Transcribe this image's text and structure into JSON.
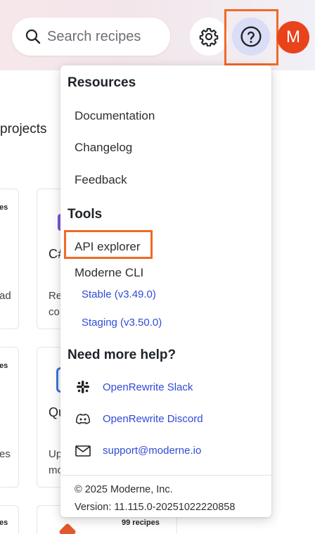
{
  "header": {
    "search_placeholder": "Search recipes",
    "settings_icon": "gear-icon",
    "help_icon": "help-circle-icon",
    "avatar_initial": "M",
    "accent_color": "#f06a26",
    "avatar_color": "#e9431c"
  },
  "background": {
    "section_title_fragment": "projects",
    "cards": [
      {
        "count": "es",
        "text1": "ad",
        "title": ""
      },
      {
        "title": "C#",
        "text1": "Re",
        "text2": "co"
      },
      {
        "count": "es",
        "text1": "es"
      },
      {
        "title": "Qu",
        "text1": "Up",
        "text2": "mo"
      },
      {
        "count": "es"
      },
      {
        "count": "99 recipes"
      }
    ]
  },
  "menu": {
    "resources_heading": "Resources",
    "resources": [
      "Documentation",
      "Changelog",
      "Feedback"
    ],
    "tools_heading": "Tools",
    "api_explorer": "API explorer",
    "cli_label": "Moderne CLI",
    "cli_links": [
      "Stable (v3.49.0)",
      "Staging (v3.50.0)"
    ],
    "help_heading": "Need more help?",
    "help_links": [
      {
        "label": "OpenRewrite Slack",
        "icon": "slack-icon"
      },
      {
        "label": "OpenRewrite Discord",
        "icon": "discord-icon"
      },
      {
        "label": "support@moderne.io",
        "icon": "mail-icon"
      }
    ],
    "copyright": "© 2025 Moderne, Inc.",
    "version": "Version: 11.115.0-20251022220858",
    "link_color": "#2f4bd6"
  }
}
